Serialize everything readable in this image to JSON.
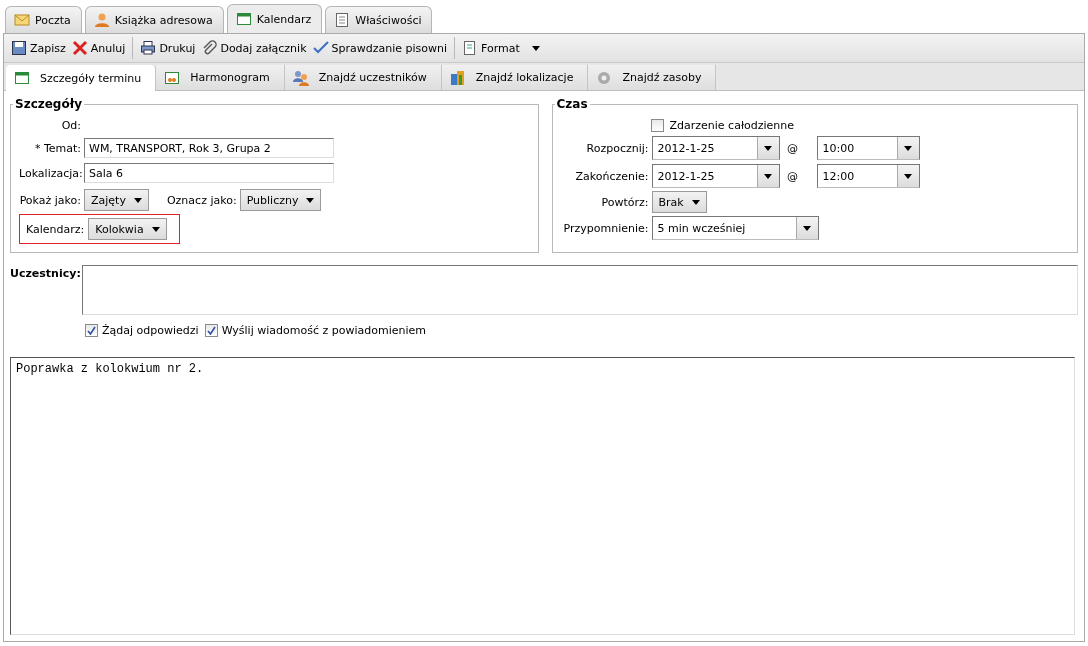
{
  "app_tabs": [
    {
      "label": "Poczta",
      "selected": false
    },
    {
      "label": "Książka adresowa",
      "selected": false
    },
    {
      "label": "Kalendarz",
      "selected": true
    },
    {
      "label": "Właściwości",
      "selected": false
    }
  ],
  "toolbar_groups": [
    [
      {
        "label": "Zapisz",
        "kind": "button"
      },
      {
        "label": "Anuluj",
        "kind": "button"
      }
    ],
    [
      {
        "label": "Drukuj",
        "kind": "button"
      },
      {
        "label": "Dodaj załącznik",
        "kind": "button"
      },
      {
        "label": "Sprawdzanie pisowni",
        "kind": "button"
      }
    ],
    [
      {
        "label": "Format",
        "kind": "menu"
      }
    ]
  ],
  "sub_tabs": [
    {
      "label": "Szczegóły terminu",
      "selected": true
    },
    {
      "label": "Harmonogram",
      "selected": false
    },
    {
      "label": "Znajdź uczestników",
      "selected": false
    },
    {
      "label": "Znajdź lokalizacje",
      "selected": false
    },
    {
      "label": "Znajdź zasoby",
      "selected": false
    }
  ],
  "details": {
    "title": "Szczegóły",
    "from_label": "Od:",
    "subject": {
      "label": "Temat:",
      "required_mark": "*",
      "value": "WM, TRANSPORT, Rok 3, Grupa 2"
    },
    "location": {
      "label": "Lokalizacja:",
      "value": "Sala 6"
    },
    "show_as": {
      "label": "Pokaż jako:",
      "value": "Zajęty"
    },
    "mark_as": {
      "label": "Oznacz jako:",
      "value": "Publiczny"
    },
    "calendar": {
      "label": "Kalendarz:",
      "value": "Kolokwia",
      "highlighted": true
    }
  },
  "time": {
    "title": "Czas",
    "all_day": {
      "label": "Zdarzenie całodzienne",
      "checked": false
    },
    "start": {
      "label": "Rozpocznij:",
      "date": "2012-1-25",
      "at": "@",
      "time": "10:00"
    },
    "end": {
      "label": "Zakończenie:",
      "date": "2012-1-25",
      "at": "@",
      "time": "12:00"
    },
    "repeat": {
      "label": "Powtórz:",
      "value": "Brak"
    },
    "reminder": {
      "label": "Przypomnienie:",
      "value": "5 min wcześniej"
    }
  },
  "attendees": {
    "label": "Uczestnicy:",
    "options": [
      {
        "label": "Żądaj odpowiedzi",
        "checked": true
      },
      {
        "label": "Wyślij wiadomość z powiadomieniem",
        "checked": true
      }
    ]
  },
  "body": {
    "text": "Poprawka z kolokwium nr 2."
  }
}
